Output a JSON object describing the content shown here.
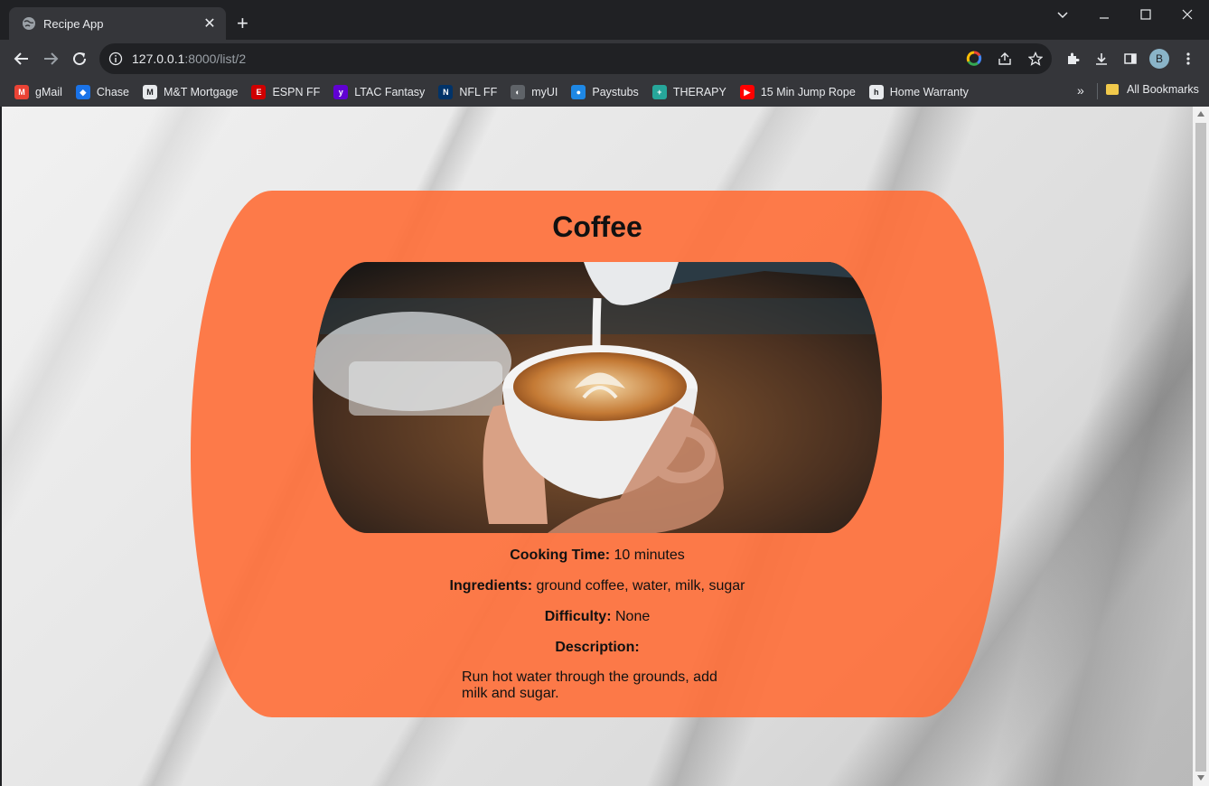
{
  "browser": {
    "tab_title": "Recipe App",
    "url_host": "127.0.0.1",
    "url_rest": ":8000/list/2",
    "profile_initial": "B"
  },
  "bookmarks": [
    {
      "label": "gMail",
      "color": "#ea4335",
      "glyph": "M"
    },
    {
      "label": "Chase",
      "color": "#1a73e8",
      "glyph": "◆"
    },
    {
      "label": "M&T Mortgage",
      "color": "#e8eaed",
      "glyph": "M"
    },
    {
      "label": "ESPN FF",
      "color": "#d00000",
      "glyph": "E"
    },
    {
      "label": "LTAC Fantasy",
      "color": "#6001d2",
      "glyph": "y"
    },
    {
      "label": "NFL FF",
      "color": "#013369",
      "glyph": "N"
    },
    {
      "label": "myUI",
      "color": "#5f6368",
      "glyph": "◐"
    },
    {
      "label": "Paystubs",
      "color": "#1e88e5",
      "glyph": "●"
    },
    {
      "label": "THERAPY",
      "color": "#26a69a",
      "glyph": "+"
    },
    {
      "label": "15 Min Jump Rope",
      "color": "#ff0000",
      "glyph": "▶"
    },
    {
      "label": "Home Warranty",
      "color": "#e8eaed",
      "glyph": "h"
    }
  ],
  "all_bookmarks_label": "All Bookmarks",
  "recipe": {
    "title": "Coffee",
    "cooking_time_label": "Cooking Time:",
    "cooking_time_value": "10 minutes",
    "ingredients_label": "Ingredients:",
    "ingredients_value": "ground coffee, water, milk, sugar",
    "difficulty_label": "Difficulty:",
    "difficulty_value": "None",
    "description_label": "Description:",
    "description_value": "Run hot water through the grounds, add milk and sugar."
  },
  "colors": {
    "card": "#ff6e37",
    "chrome_dark": "#202124",
    "chrome_toolbar": "#35363a"
  }
}
